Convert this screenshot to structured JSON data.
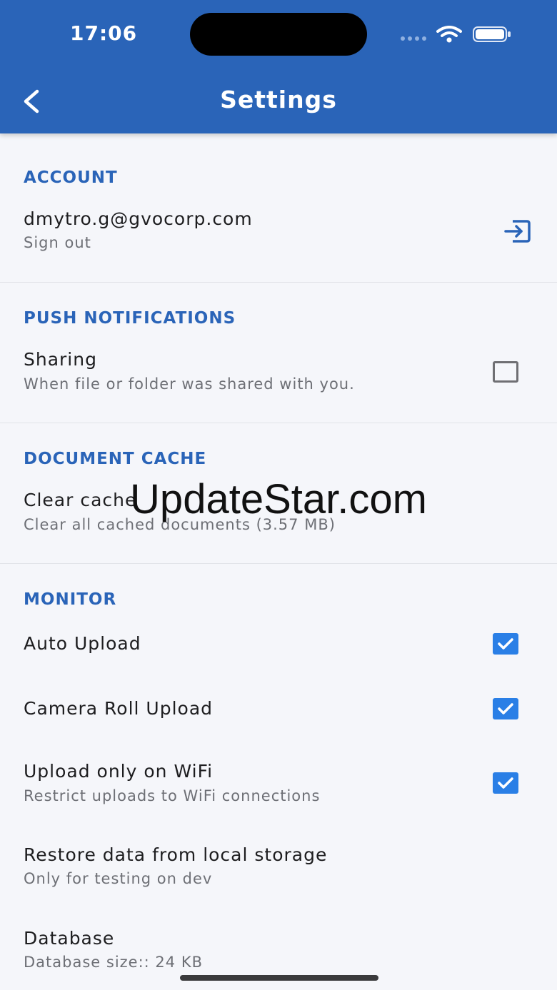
{
  "status_bar": {
    "time": "17:06"
  },
  "header": {
    "title": "Settings"
  },
  "account": {
    "section_title": "ACCOUNT",
    "email": "dmytro.g@gvocorp.com",
    "action_label": "Sign out"
  },
  "push": {
    "section_title": "PUSH NOTIFICATIONS",
    "sharing_title": "Sharing",
    "sharing_sub": "When file or folder was shared with you.",
    "sharing_checked": false
  },
  "cache": {
    "section_title": "DOCUMENT CACHE",
    "clear_title": "Clear cache",
    "clear_sub": "Clear all cached documents (3.57 MB)"
  },
  "monitor": {
    "section_title": "MONITOR",
    "auto_upload": {
      "title": "Auto Upload",
      "checked": true
    },
    "camera_roll": {
      "title": "Camera Roll Upload",
      "checked": true
    },
    "wifi_only": {
      "title": "Upload only on WiFi",
      "sub": "Restrict uploads to WiFi connections",
      "checked": true
    },
    "restore": {
      "title": "Restore data from local storage",
      "sub": "Only for testing on dev"
    },
    "database": {
      "title": "Database",
      "sub": "Database size:: 24 KB"
    }
  },
  "watermark": "UpdateStar.com",
  "colors": {
    "primary": "#2a64b8",
    "checkbox_on": "#2a7fe6",
    "background": "#f5f6fa"
  }
}
